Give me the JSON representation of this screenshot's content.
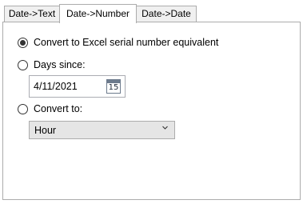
{
  "tabs": [
    {
      "label": "Date->Text",
      "active": false
    },
    {
      "label": "Date->Number",
      "active": true
    },
    {
      "label": "Date->Date",
      "active": false
    }
  ],
  "options": {
    "serial": {
      "label": "Convert to Excel serial number equivalent",
      "selected": true
    },
    "days_since": {
      "label": "Days since:",
      "selected": false
    },
    "convert_to": {
      "label": "Convert to:",
      "selected": false
    }
  },
  "date_picker": {
    "value": "4/11/2021",
    "icon": "calendar-icon",
    "icon_text": "15"
  },
  "unit_select": {
    "selected": "Hour",
    "icon": "chevron-down-icon"
  },
  "colors": {
    "panel_border": "#acacac",
    "tab_inactive_bg": "#f0f0f0",
    "dropdown_bg": "#e5e5e5"
  }
}
